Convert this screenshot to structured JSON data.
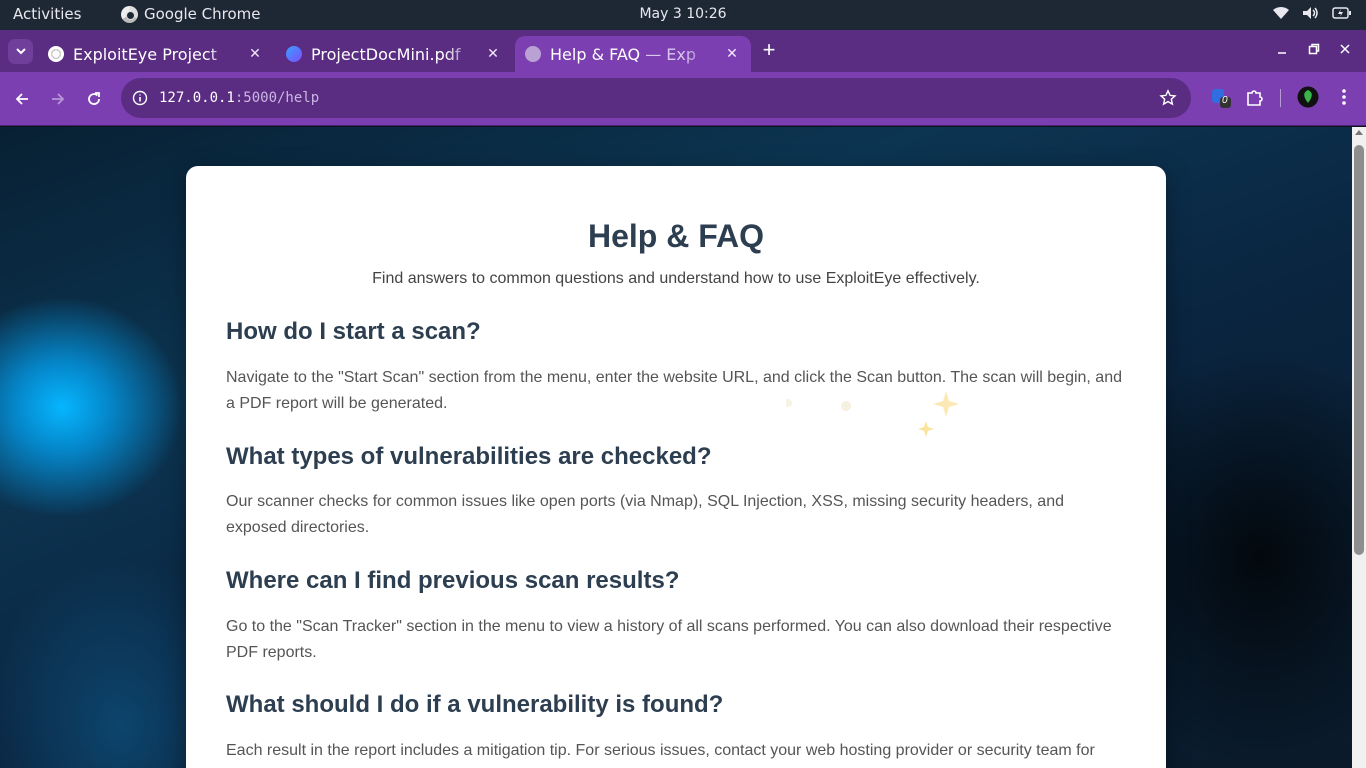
{
  "topbar": {
    "activities": "Activities",
    "app_name": "Google Chrome",
    "clock": "May 3  10:26"
  },
  "tabs": [
    {
      "title": "ExploitEye Project",
      "favicon": "openai-icon",
      "active": false
    },
    {
      "title": "ProjectDocMini.pdf",
      "favicon": "pdf-viewer-icon",
      "active": false
    },
    {
      "title_main": "Help & FAQ",
      "title_rest": " — Exp",
      "favicon": "globe-icon",
      "active": true
    }
  ],
  "toolbar": {
    "url_host": "127.0.0.1",
    "url_path": ":5000/help",
    "extension_badge": "0"
  },
  "page": {
    "title": "Help & FAQ",
    "subtitle": "Find answers to common questions and understand how to use ExploitEye effectively.",
    "faqs": [
      {
        "question": "How do I start a scan?",
        "answer": "Navigate to the \"Start Scan\" section from the menu, enter the website URL, and click the Scan button. The scan will begin, and a PDF report will be generated."
      },
      {
        "question": "What types of vulnerabilities are checked?",
        "answer": "Our scanner checks for common issues like open ports (via Nmap), SQL Injection, XSS, missing security headers, and exposed directories."
      },
      {
        "question": "Where can I find previous scan results?",
        "answer": "Go to the \"Scan Tracker\" section in the menu to view a history of all scans performed. You can also download their respective PDF reports."
      },
      {
        "question": "What should I do if a vulnerability is found?",
        "answer": "Each result in the report includes a mitigation tip. For serious issues, contact your web hosting provider or security team for"
      }
    ]
  },
  "colors": {
    "tabstrip": "#5a2d83",
    "toolbar": "#7c3fb1",
    "heading": "#2c3e50",
    "body_text": "#555555"
  }
}
